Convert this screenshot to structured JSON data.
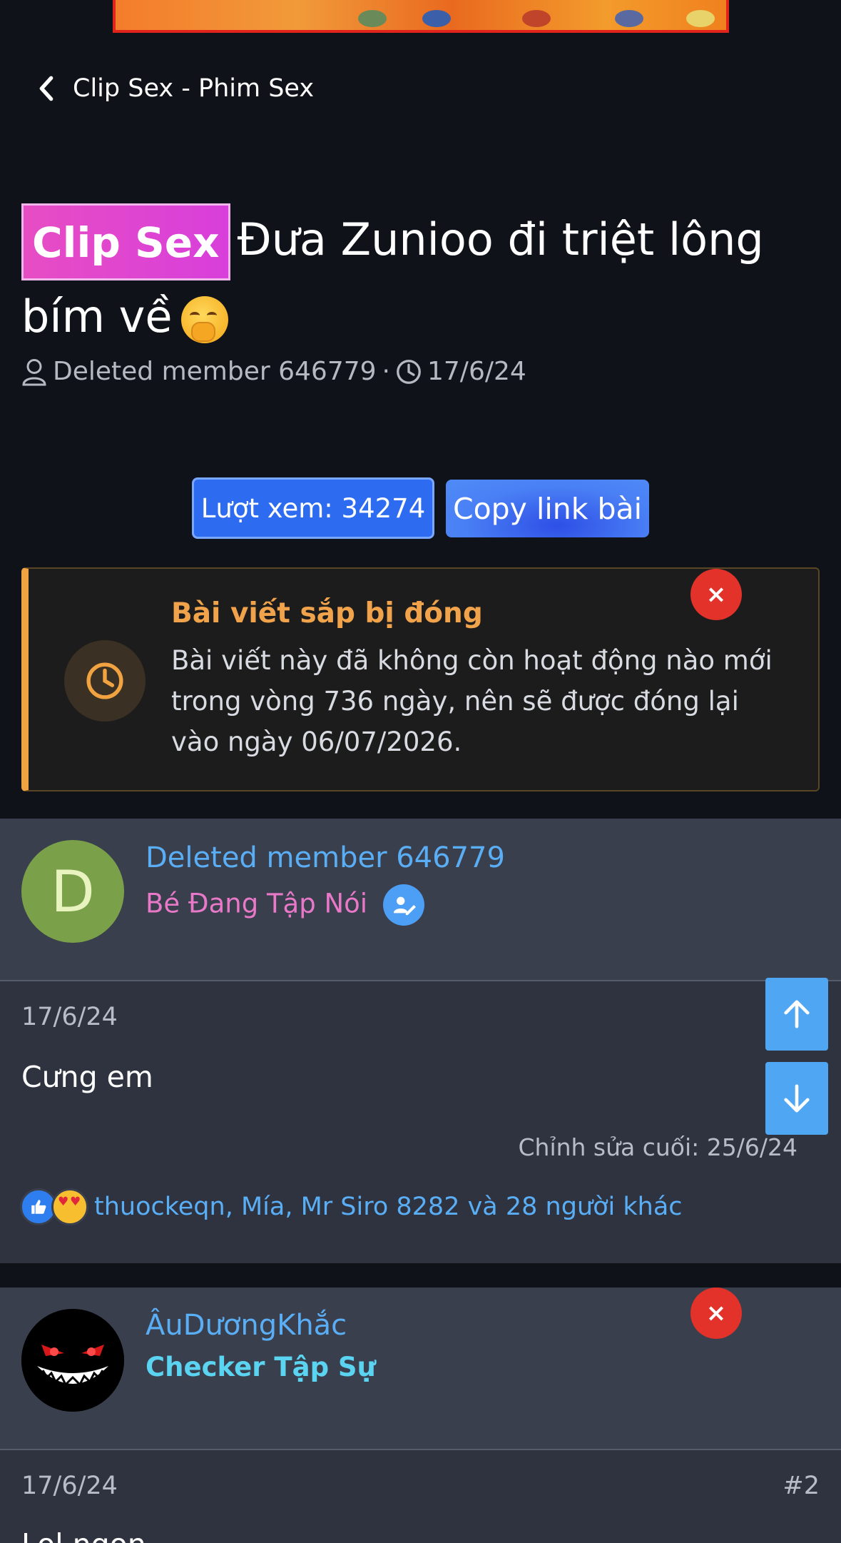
{
  "banner": {
    "icon": "game-art-banner"
  },
  "nav": {
    "back_label": "Clip Sex - Phim Sex",
    "back_icon": "chevron-left-icon"
  },
  "thread": {
    "prefix": "Clip Sex",
    "title": "Đưa Zunioo đi triệt lông bím về",
    "title_emoji": "face-with-hand-over-mouth-emoji",
    "author": "Deleted member 646779",
    "separator": "·",
    "date": "17/6/24"
  },
  "actions": {
    "views_label": "Lượt xem: 34274",
    "copy_label": "Copy link bài"
  },
  "notice": {
    "title": "Bài viết sắp bị đóng",
    "body": "Bài viết này đã không còn hoạt động nào mới trong vòng 736 ngày, nên sẽ được đóng lại vào ngày 06/07/2026.",
    "close": "×",
    "accent": "#f0a340"
  },
  "posts": [
    {
      "avatar_letter": "D",
      "username": "Deleted member 646779",
      "rank": "Bé Đang Tập Nói",
      "rank_color": "#e879c8",
      "date": "17/6/24",
      "content": "Cưng em",
      "edited": "Chỉnh sửa cuối: 25/6/24",
      "reactions": "thuockeqn, Mía, Mr Siro 8282 và 28 người khác"
    },
    {
      "username": "ÂuDươngKhắc",
      "rank": "Checker Tập Sự",
      "rank_color": "#5ad4f0",
      "date": "17/6/24",
      "number": "#2",
      "content": "Lol ngon",
      "close": "×"
    }
  ]
}
